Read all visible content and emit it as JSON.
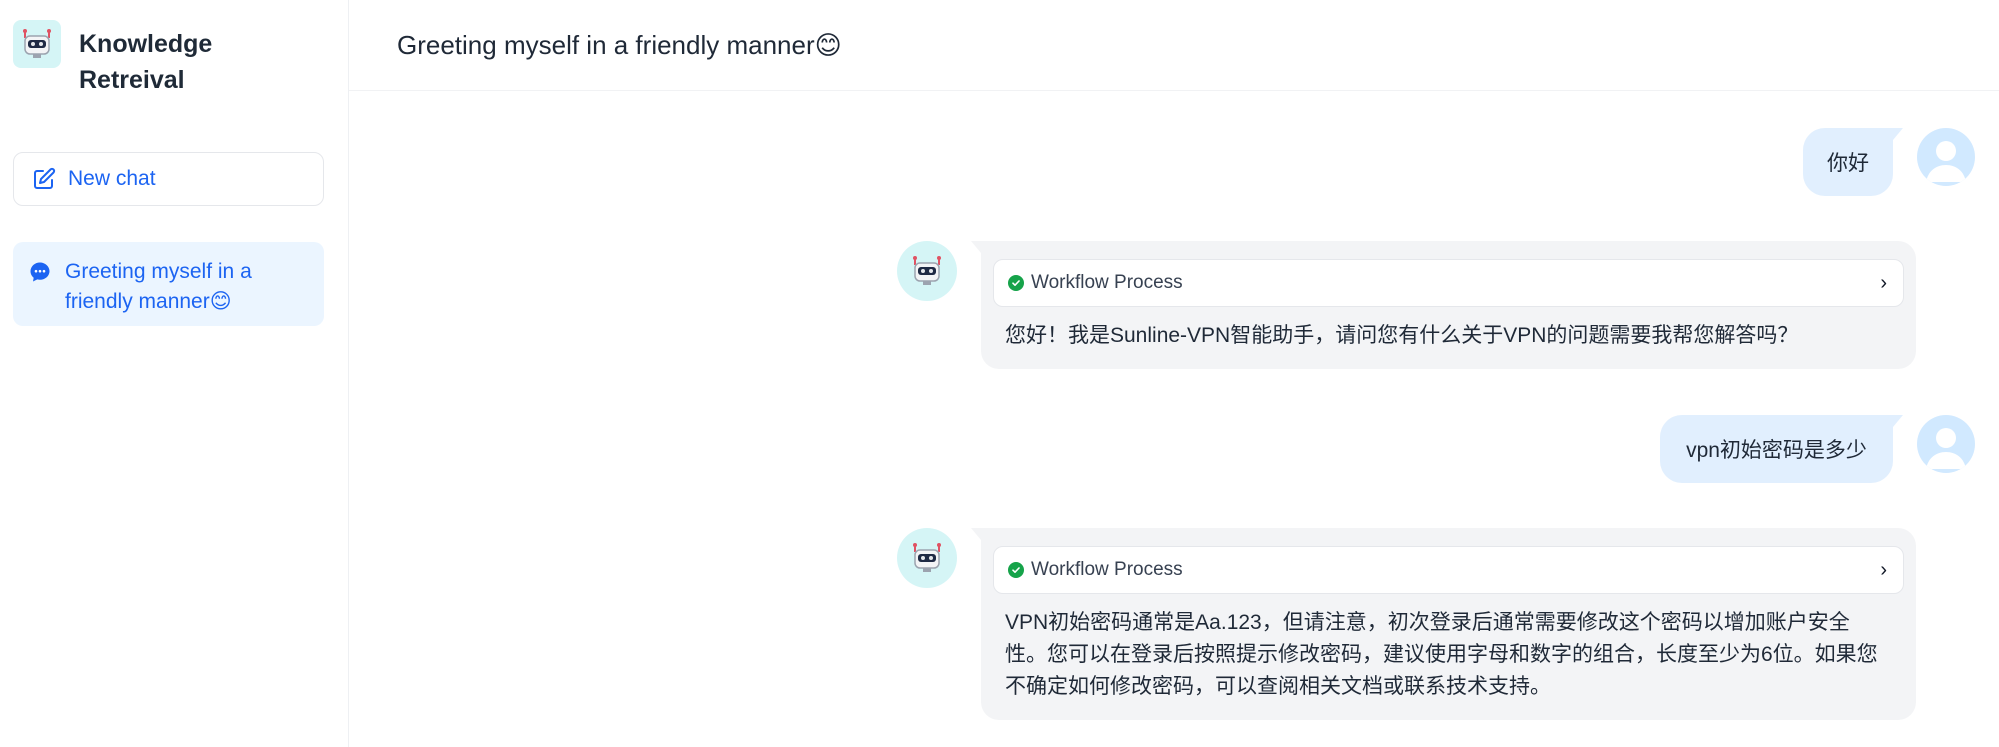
{
  "app": {
    "title_line1": "Knowledge",
    "title_line2": "Retreival",
    "logo_icon": "robot-icon"
  },
  "sidebar": {
    "new_chat_label": "New chat",
    "new_chat_icon": "edit-icon",
    "conversations": [
      {
        "label_line1": "Greeting myself in a",
        "label_line2": "friendly manner😊",
        "icon": "chat-bubble-icon",
        "active": true
      }
    ]
  },
  "header": {
    "title": "Greeting myself in a friendly manner😊"
  },
  "messages": [
    {
      "role": "user",
      "text": "你好"
    },
    {
      "role": "assistant",
      "workflow_label": "Workflow Process",
      "workflow_status": "success",
      "text": "您好！我是Sunline-VPN智能助手，请问您有什么关于VPN的问题需要我帮您解答吗？"
    },
    {
      "role": "user",
      "text": "vpn初始密码是多少"
    },
    {
      "role": "assistant",
      "workflow_label": "Workflow Process",
      "workflow_status": "success",
      "text_line1": "VPN初始密码通常是Aa.123，但请注意，初次登录后通常需要修改这个密码以增加账户安全",
      "text_line2": "性。您可以在登录后按照提示修改密码，建议使用字母和数字的组合，长度至少为6位。如果您",
      "text_line3": "不确定如何修改密码，可以查阅相关文档或联系技术支持。"
    }
  ],
  "colors": {
    "accent": "#1c64f2",
    "user_bubble": "#e1effe",
    "bot_bubble": "#f3f4f6",
    "success": "#16a34a"
  }
}
